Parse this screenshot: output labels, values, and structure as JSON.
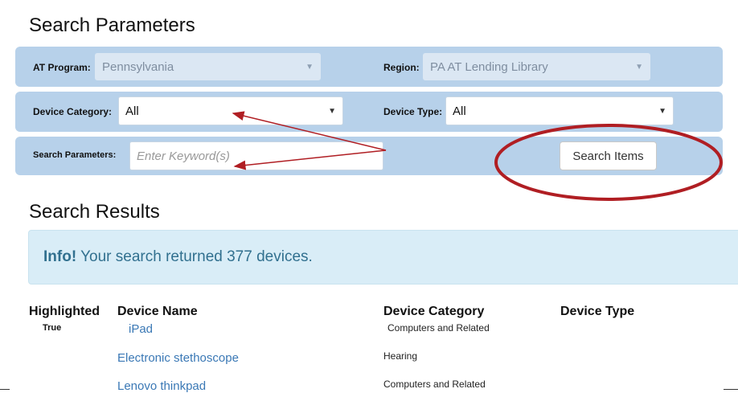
{
  "search_section": {
    "title": "Search Parameters"
  },
  "filters": {
    "at_program": {
      "label": "AT Program:",
      "value": "Pennsylvania"
    },
    "region": {
      "label": "Region:",
      "value": "PA AT Lending Library"
    },
    "device_category": {
      "label": "Device Category:",
      "value": "All"
    },
    "device_type": {
      "label": "Device Type:",
      "value": "All"
    },
    "keyword": {
      "label": "Search Parameters:",
      "placeholder": "Enter Keyword(s)"
    },
    "search_button": "Search Items"
  },
  "results_section": {
    "title": "Search Results",
    "info_strong": "Info!",
    "info_text": " Your search returned 377 devices."
  },
  "table": {
    "headers": [
      "Highlighted",
      "Device Name",
      "Device Category",
      "Device Type"
    ],
    "rows": [
      {
        "highlighted": "True",
        "name": "iPad",
        "category": "Computers and Related",
        "type": ""
      },
      {
        "highlighted": "",
        "name": "Electronic stethoscope",
        "category": "Hearing",
        "type": ""
      },
      {
        "highlighted": "",
        "name": "Lenovo thinkpad",
        "category": "Computers and Related",
        "type": ""
      }
    ]
  },
  "colors": {
    "panel": "#b7d1ea",
    "annotation": "#b01e23",
    "link": "#3a78b5",
    "info_bg": "#d9edf7"
  }
}
